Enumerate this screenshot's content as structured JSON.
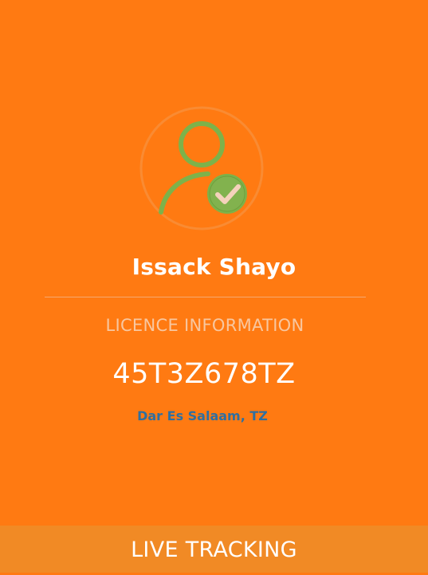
{
  "profile": {
    "avatar_icon": "verified-user-icon",
    "name": "Issack Shayo"
  },
  "licence": {
    "section_label": "LICENCE INFORMATION",
    "number": "45T3Z678TZ",
    "location": "Dar Es Salaam, TZ"
  },
  "footer": {
    "button_label": "LIVE TRACKING"
  },
  "colors": {
    "background": "#ff7a12",
    "footer": "#f18a25",
    "avatar_green": "#7db24a",
    "location_text": "#2f6fa0"
  }
}
